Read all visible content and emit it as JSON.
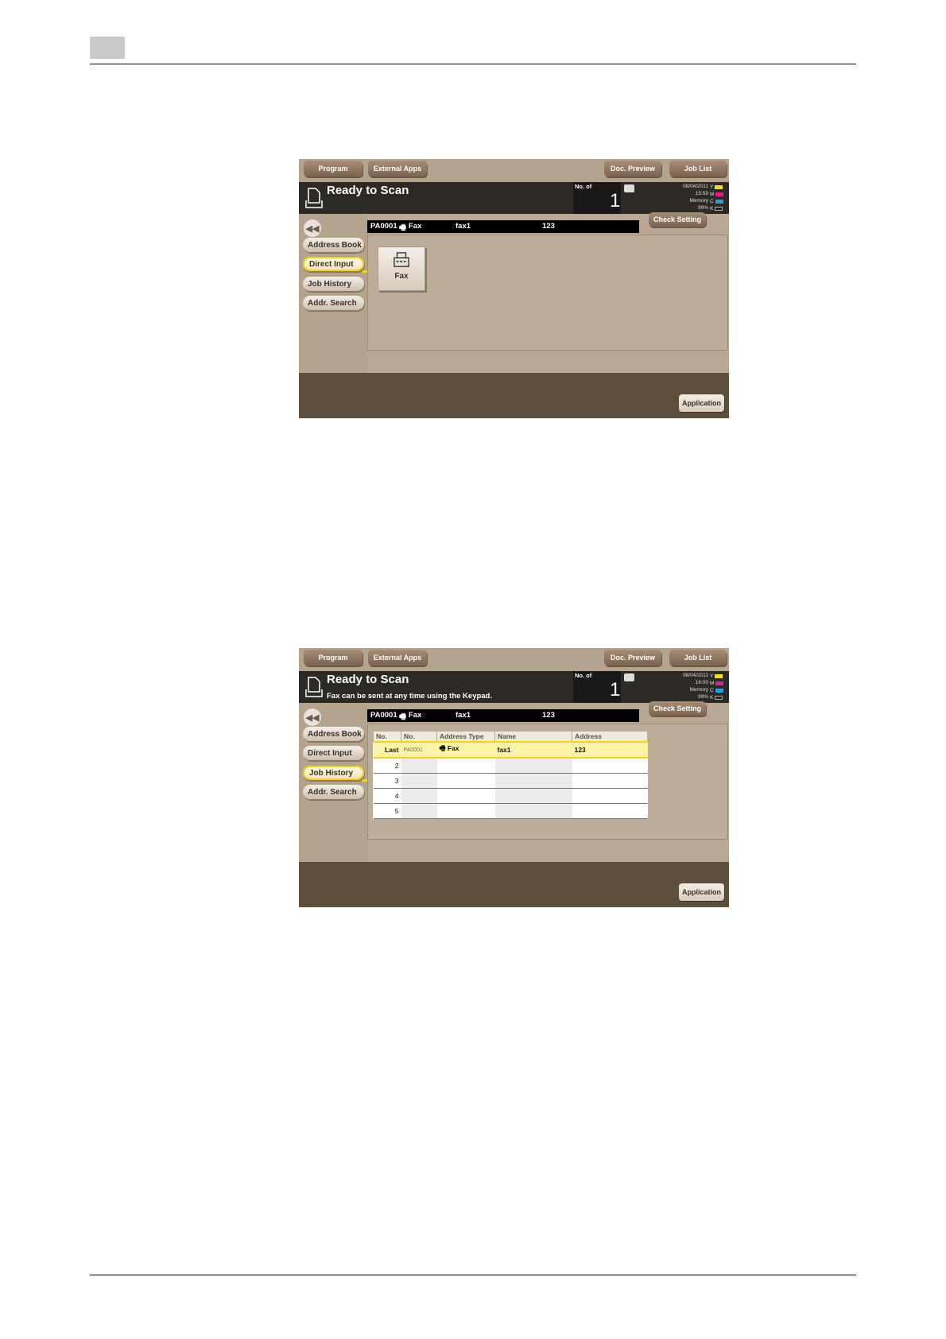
{
  "screen1": {
    "topbar": {
      "program": "Program",
      "external_apps": "External Apps",
      "doc_preview": "Doc. Preview",
      "job_list": "Job List"
    },
    "status": {
      "title": "Ready to Scan",
      "subtitle": ""
    },
    "counter": {
      "label": "No. of",
      "value": "1"
    },
    "info": {
      "date": "08/04/2011",
      "time": "15:59",
      "memory_label": "Memory",
      "memory_value": "99%"
    },
    "toner": [
      "Y",
      "M",
      "C",
      "K"
    ],
    "sidebar": [
      "Address Book",
      "Direct Input",
      "Job History",
      "Addr. Search"
    ],
    "active": "Direct Input",
    "destination": {
      "id": "PA0001",
      "type": "Fax",
      "name": "fax1",
      "address": "123"
    },
    "check_setting": "Check Setting",
    "fax_button": "Fax",
    "application": "Application"
  },
  "screen2": {
    "topbar": {
      "program": "Program",
      "external_apps": "External Apps",
      "doc_preview": "Doc. Preview",
      "job_list": "Job List"
    },
    "status": {
      "title": "Ready to Scan",
      "subtitle": "Fax can be sent at any time using the Keypad."
    },
    "counter": {
      "label": "No. of",
      "value": "1"
    },
    "info": {
      "date": "08/04/2011",
      "time": "16:00",
      "memory_label": "Memory",
      "memory_value": "99%"
    },
    "toner": [
      "Y",
      "M",
      "C",
      "K"
    ],
    "sidebar": [
      "Address Book",
      "Direct Input",
      "Job History",
      "Addr. Search"
    ],
    "active": "Job History",
    "destination": {
      "id": "PA0001",
      "type": "Fax",
      "name": "fax1",
      "address": "123"
    },
    "check_setting": "Check Setting",
    "table": {
      "headers": [
        "No.",
        "No.",
        "Address Type",
        "Name",
        "Address"
      ],
      "rows": [
        [
          "Last",
          "PA0001",
          "Fax",
          "fax1",
          "123"
        ],
        [
          "2",
          "",
          "",
          "",
          ""
        ],
        [
          "3",
          "",
          "",
          "",
          ""
        ],
        [
          "4",
          "",
          "",
          "",
          ""
        ],
        [
          "5",
          "",
          "",
          "",
          ""
        ]
      ]
    },
    "application": "Application"
  },
  "colors": {
    "yellow": "#f2e21e",
    "magenta": "#e0208c",
    "cyan": "#1ea4e0",
    "black": "#222222"
  }
}
